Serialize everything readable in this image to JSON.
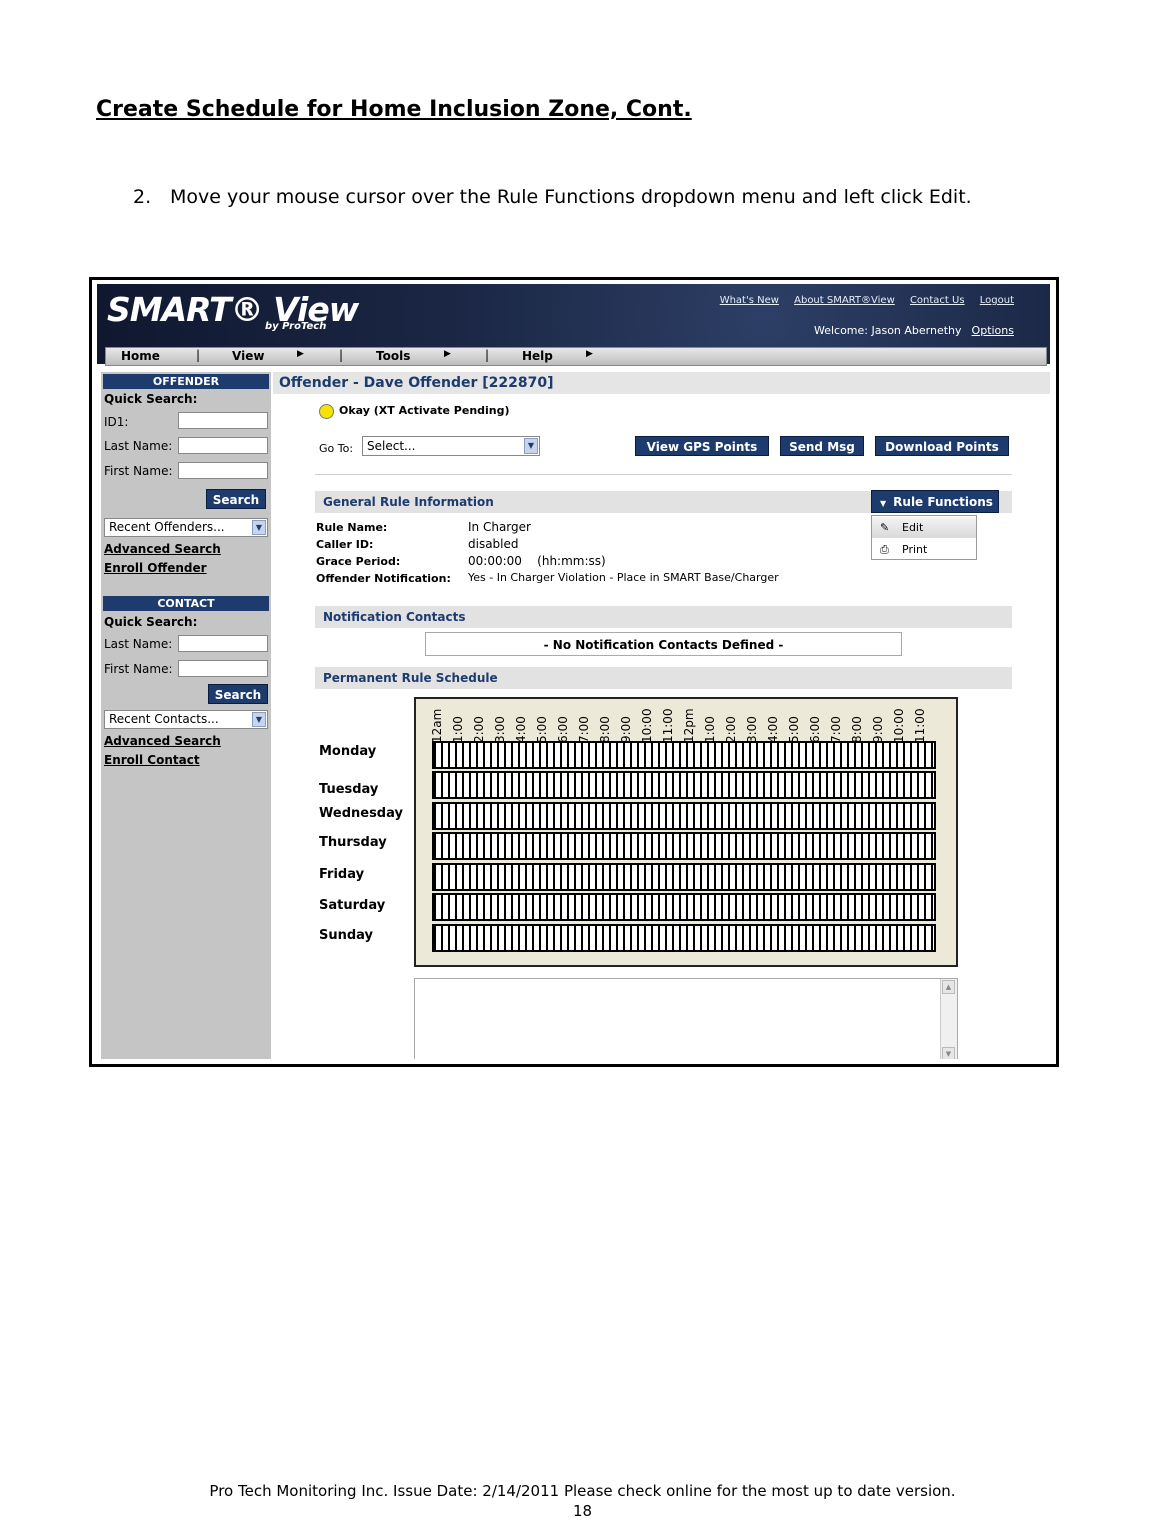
{
  "doc": {
    "title": "Create Schedule for Home Inclusion Zone, Cont.",
    "step_number": "2.",
    "step_text": "Move your mouse cursor over the Rule Functions dropdown menu and left click Edit.",
    "footer_line1": "Pro Tech Monitoring Inc. Issue Date: 2/14/2011 Please check online for the most up to date version.",
    "footer_page": "18"
  },
  "app": {
    "logo": "SMART® View",
    "logo_sub": "by ProTech",
    "top_links": [
      "What's New",
      "About SMART®View",
      "Contact Us",
      "Logout"
    ],
    "welcome": "Welcome: Jason Abernethy",
    "options": "Options",
    "menu": [
      "Home",
      "View",
      "Tools",
      "Help"
    ]
  },
  "sidebar": {
    "offender_head": "OFFENDER",
    "quick_search": "Quick Search:",
    "id1": "ID1:",
    "last_name": "Last Name:",
    "first_name": "First Name:",
    "search": "Search",
    "recent_offenders": "Recent Offenders...",
    "advanced_search": "Advanced Search",
    "enroll_offender": "Enroll Offender",
    "contact_head": "CONTACT",
    "recent_contacts": "Recent Contacts...",
    "enroll_contact": "Enroll Contact"
  },
  "main": {
    "title": "Offender - Dave Offender [222870]",
    "status": "Okay (XT Activate Pending)",
    "goto_label": "Go To:",
    "goto_value": "Select...",
    "buttons": [
      "View GPS Points",
      "Send Msg",
      "Download Points"
    ],
    "general_head": "General Rule Information",
    "rule_functions": "Rule Functions",
    "rule_menu": [
      "Edit",
      "Print"
    ],
    "info": [
      {
        "label": "Rule Name:",
        "value": "In Charger"
      },
      {
        "label": "Caller ID:",
        "value": "disabled"
      },
      {
        "label": "Grace Period:",
        "value": "00:00:00    (hh:mm:ss)"
      },
      {
        "label": "Offender Notification:",
        "value": "Yes - In Charger Violation - Place in SMART Base/Charger"
      }
    ],
    "notification_head": "Notification Contacts",
    "no_contacts": "- No Notification Contacts Defined -",
    "schedule_head": "Permanent Rule Schedule",
    "hours": [
      "12am",
      "1:00",
      "2:00",
      "3:00",
      "4:00",
      "5:00",
      "6:00",
      "7:00",
      "8:00",
      "9:00",
      "10:00",
      "11:00",
      "12pm",
      "1:00",
      "2:00",
      "3:00",
      "4:00",
      "5:00",
      "6:00",
      "7:00",
      "8:00",
      "9:00",
      "10:00",
      "11:00"
    ],
    "days": [
      "Monday",
      "Tuesday",
      "Wednesday",
      "Thursday",
      "Friday",
      "Saturday",
      "Sunday"
    ]
  },
  "colors": {
    "nav": "#1e3b6e",
    "sidebar": "#c5c5c5",
    "status": "#f5e400"
  }
}
